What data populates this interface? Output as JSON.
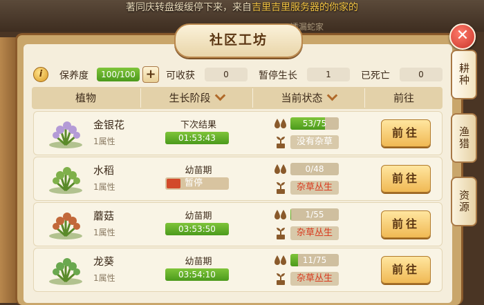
{
  "marquee": {
    "text_a": "著同庆转盘缓缓停下来，来自",
    "text_b": "吉里吉里服务器的",
    "text_c": "你家的"
  },
  "ghost_text": "透漏蛇家",
  "title": "社区工坊",
  "close_label": "✕",
  "side_tabs": [
    {
      "label": "耕种"
    },
    {
      "label": "渔猎"
    },
    {
      "label": "资源"
    }
  ],
  "stats": {
    "info_label": "i",
    "maintenance_label": "保养度",
    "maintenance_value": "100/100",
    "harvestable_label": "可收获",
    "harvestable_value": "0",
    "paused_label": "暂停生长",
    "paused_value": "1",
    "dead_label": "已死亡",
    "dead_value": "0",
    "plus_label": "+"
  },
  "columns": {
    "plant": "植物",
    "stage": "生长阶段",
    "status": "当前状态",
    "goto": "前往"
  },
  "rows": [
    {
      "name": "金银花",
      "attr": "1属性",
      "stage": "下次结果",
      "timer": "01:53:43",
      "timer_fraction": 1.0,
      "paused": false,
      "water": "53/75",
      "water_fraction": 0.71,
      "weed": "没有杂草",
      "weed_bad": false,
      "go": "前往",
      "plant_color": "#b49bd6"
    },
    {
      "name": "水稻",
      "attr": "1属性",
      "stage": "幼苗期",
      "timer": "暂停",
      "timer_fraction": 0,
      "paused": true,
      "water": "0/48",
      "water_fraction": 0,
      "weed": "杂草丛生",
      "weed_bad": true,
      "go": "前往",
      "plant_color": "#7fb04a"
    },
    {
      "name": "蘑菇",
      "attr": "1属性",
      "stage": "幼苗期",
      "timer": "03:53:50",
      "timer_fraction": 1.0,
      "paused": false,
      "water": "1/55",
      "water_fraction": 0.02,
      "weed": "杂草丛生",
      "weed_bad": true,
      "go": "前往",
      "plant_color": "#c2683a"
    },
    {
      "name": "龙葵",
      "attr": "1属性",
      "stage": "幼苗期",
      "timer": "03:54:10",
      "timer_fraction": 1.0,
      "paused": false,
      "water": "11/75",
      "water_fraction": 0.15,
      "weed": "杂草丛生",
      "weed_bad": true,
      "go": "前往",
      "plant_color": "#6aa84f"
    }
  ]
}
